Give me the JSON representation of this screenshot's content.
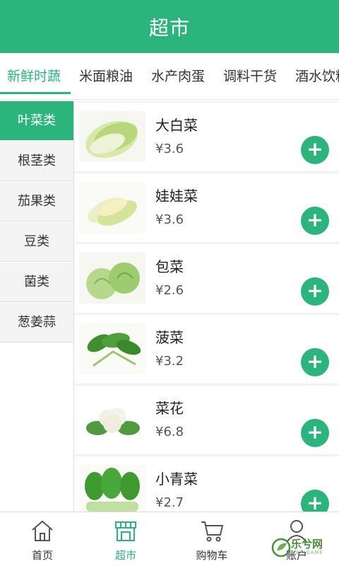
{
  "header": {
    "title": "超市"
  },
  "tabs": [
    {
      "label": "新鲜时蔬",
      "active": true
    },
    {
      "label": "米面粮油",
      "active": false
    },
    {
      "label": "水产肉蛋",
      "active": false
    },
    {
      "label": "调料干货",
      "active": false
    },
    {
      "label": "酒水饮料",
      "active": false
    }
  ],
  "sidebar": {
    "items": [
      {
        "label": "叶菜类",
        "active": true
      },
      {
        "label": "根茎类",
        "active": false
      },
      {
        "label": "茄果类",
        "active": false
      },
      {
        "label": "豆类",
        "active": false
      },
      {
        "label": "菌类",
        "active": false
      },
      {
        "label": "葱姜蒜",
        "active": false
      }
    ]
  },
  "products": [
    {
      "name": "大白菜",
      "price": "¥3.6",
      "image": "napa-cabbage",
      "add_label": "+"
    },
    {
      "name": "娃娃菜",
      "price": "¥3.6",
      "image": "baby-cabbage",
      "add_label": "+"
    },
    {
      "name": "包菜",
      "price": "¥2.6",
      "image": "cabbage",
      "add_label": "+"
    },
    {
      "name": "菠菜",
      "price": "¥3.2",
      "image": "spinach",
      "add_label": "+"
    },
    {
      "name": "菜花",
      "price": "¥6.8",
      "image": "cauliflower",
      "add_label": "+"
    },
    {
      "name": "小青菜",
      "price": "¥2.7",
      "image": "bok-choy",
      "add_label": "+"
    }
  ],
  "bottom_nav": [
    {
      "label": "首页",
      "icon": "home-icon",
      "active": false
    },
    {
      "label": "超市",
      "icon": "store-icon",
      "active": true
    },
    {
      "label": "购物车",
      "icon": "cart-icon",
      "active": false
    },
    {
      "label": "账户",
      "icon": "user-icon",
      "active": false
    }
  ],
  "watermark": {
    "text": "乐兮网",
    "sub": "LEXIGAME"
  },
  "colors": {
    "accent": "#2bb47c",
    "text": "#333333",
    "divider": "#dcdcdc"
  }
}
